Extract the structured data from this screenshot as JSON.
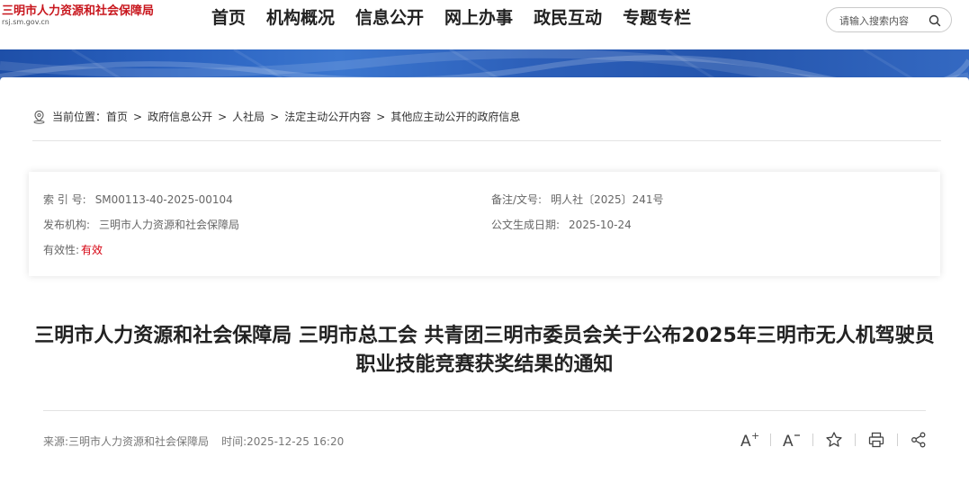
{
  "header": {
    "logo_title": "三明市人力资源和社会保障局",
    "logo_url": "rsj.sm.gov.cn",
    "nav": [
      "首页",
      "机构概况",
      "信息公开",
      "网上办事",
      "政民互动",
      "专题专栏"
    ],
    "search_placeholder": "请输入搜索内容"
  },
  "breadcrumb": {
    "prefix": "当前位置：",
    "items": [
      "首页",
      "政府信息公开",
      "人社局",
      "法定主动公开内容",
      "其他应主动公开的政府信息"
    ],
    "separator": ">"
  },
  "meta": {
    "index_label": "索 引 号:",
    "index_value": "SM00113-40-2025-00104",
    "doc_no_label": "备注/文号:",
    "doc_no_value": "明人社〔2025〕241号",
    "publisher_label": "发布机构:",
    "publisher_value": "三明市人力资源和社会保障局",
    "date_label": "公文生成日期:",
    "date_value": "2025-10-24",
    "validity_label": "有效性:",
    "validity_value": "有效"
  },
  "article": {
    "title": "三明市人力资源和社会保障局 三明市总工会 共青团三明市委员会关于公布2025年三明市无人机驾驶员职业技能竞赛获奖结果的通知",
    "source_label": "来源:",
    "source_value": "三明市人力资源和社会保障局",
    "time_label": "时间:",
    "time_value": "2025-12-25 16:20"
  },
  "tools": {
    "font_increase": "A+",
    "font_decrease": "A-"
  },
  "colors": {
    "brand_red": "#c8161d",
    "valid_red": "#d6000f",
    "banner_blue": "#2a62c0"
  }
}
